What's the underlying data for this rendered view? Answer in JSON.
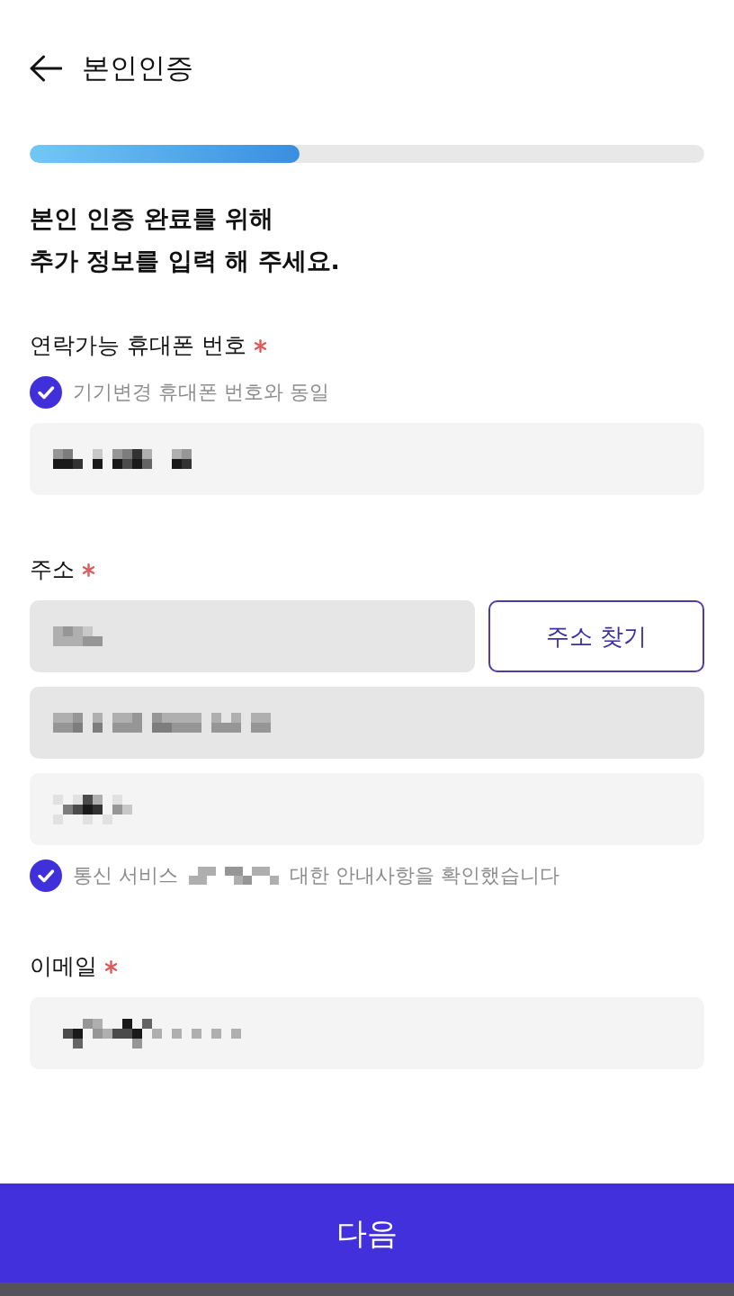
{
  "header": {
    "title": "본인인증"
  },
  "progress": {
    "level": 0.4
  },
  "heading": "본인 인증 완료를 위해\n추가 정보를 입력 해 주세요.",
  "sections": [
    {
      "label": "연락가능 휴대폰 번호",
      "required": true,
      "items": [
        {
          "kind": "checkbox",
          "label": [
            "기기변경 휴대폰 번호와 동일"
          ],
          "checked": true
        },
        {
          "kind": "field",
          "disabled": false
        }
      ]
    },
    {
      "label": "주소",
      "required": true,
      "items": [
        {
          "kind": "field_with_button",
          "disabled": true,
          "button": "주소 찾기"
        },
        {
          "kind": "field",
          "disabled": true
        },
        {
          "kind": "field",
          "disabled": false
        },
        {
          "kind": "checkbox",
          "label": [
            "통신 서비스",
            "대한 안내사항을 확인했습니다"
          ],
          "checked": true
        }
      ]
    },
    {
      "label": "이메일",
      "required": true,
      "items": [
        {
          "kind": "field",
          "disabled": false
        }
      ]
    }
  ],
  "next_button": "다음"
}
